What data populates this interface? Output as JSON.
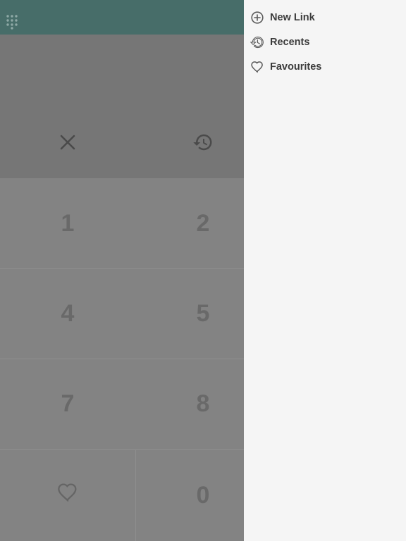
{
  "drawer": {
    "items": [
      {
        "label": "New Link",
        "icon": "add-circle-icon"
      },
      {
        "label": "Recents",
        "icon": "history-icon"
      },
      {
        "label": "Favourites",
        "icon": "heart-icon"
      }
    ]
  },
  "keypad": {
    "keys": [
      {
        "label": "1"
      },
      {
        "label": "2"
      },
      {
        "label": "4"
      },
      {
        "label": "5"
      },
      {
        "label": "7"
      },
      {
        "label": "8"
      },
      {
        "label": "0"
      }
    ]
  },
  "colors": {
    "topbar": "#476d69",
    "display": "#767676",
    "keypad": "#838383",
    "drawer": "#f5f5f5"
  }
}
